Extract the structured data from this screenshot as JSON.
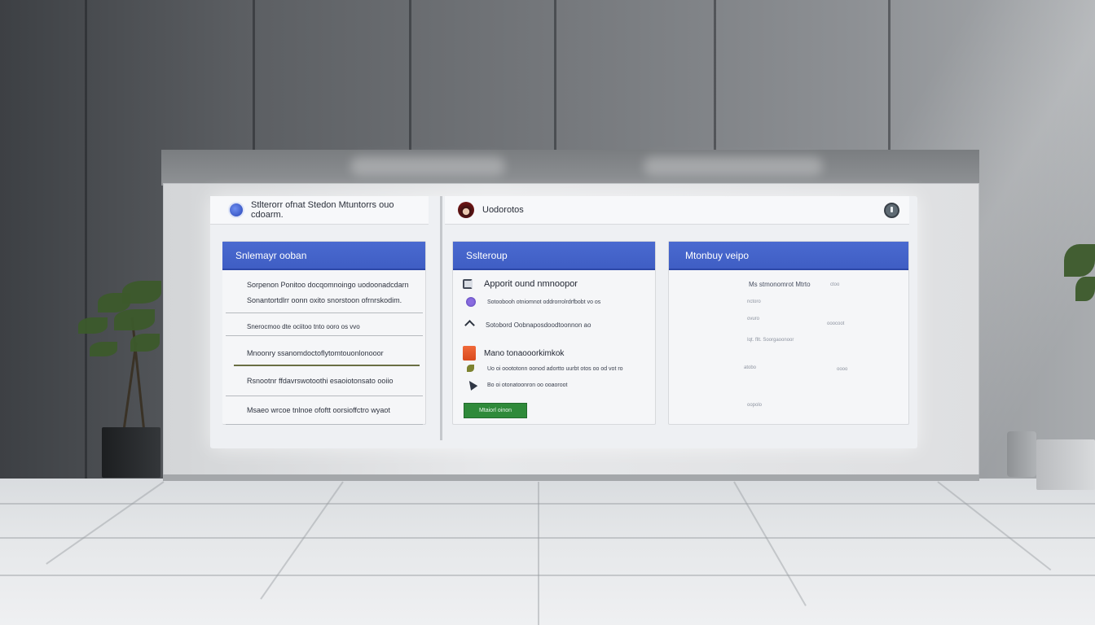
{
  "app": {
    "left_header_title": "Stlterorr ofnat Stedon Mtuntorrs ouo cdoarm.",
    "right_header_title": "Uodorotos"
  },
  "cards": {
    "left": {
      "title": "Snlemayr ooban",
      "items": [
        "Sorpenon Ponitoo docqomnoingo uodoonadcdarn",
        "Sonantortdlrr oonn oxito snorstoon ofrnrskodim.",
        "Snerocmoo dte ociitoo tnto ooro os vvo",
        "Mnoonry ssanomdoctoflytomtouonlonooor",
        "Rsnootnr ffdavrswotoothi esaoiotonsato ooiio",
        "Msaeo wrcoe tnlnoe ofoftt oorsioffctro wyaot"
      ]
    },
    "middle": {
      "title": "Sslteroup",
      "tasks": [
        {
          "label": "Apporit ound nmnoopor",
          "icon": "checkbox-icon"
        },
        {
          "label": "Sotoobooh otniomnot oddrorrolrdrfbobt vo os",
          "icon": "circle-icon"
        },
        {
          "label": "Sotobord Oobnaposdoodtoonnon ao",
          "icon": "chevron-icon"
        },
        {
          "label": "Mano tonaooorkimkok",
          "icon": "orange-app-icon"
        },
        {
          "label": "Uo oi ooototonn oonod adortto uurbt otos oo od vot ro",
          "icon": "plant-icon"
        },
        {
          "label": "Bo oi otonatoonron oo ooaoroot",
          "icon": "arrow-icon"
        }
      ],
      "button_label": "Mtaiorl oinon"
    },
    "right": {
      "title": "Mtonbuy veipo",
      "lines": [
        "Ms stmonomrot Mtrto",
        "nctoro",
        "ovuro",
        "Iqt. fllt. Soorgaoonoor",
        "atobo",
        "oopolo"
      ],
      "side_values": [
        "ctoo",
        "ooocoot",
        "oooo"
      ]
    }
  },
  "colors": {
    "card_header_blue": "#4563cb",
    "button_green": "#2f8a3a"
  }
}
